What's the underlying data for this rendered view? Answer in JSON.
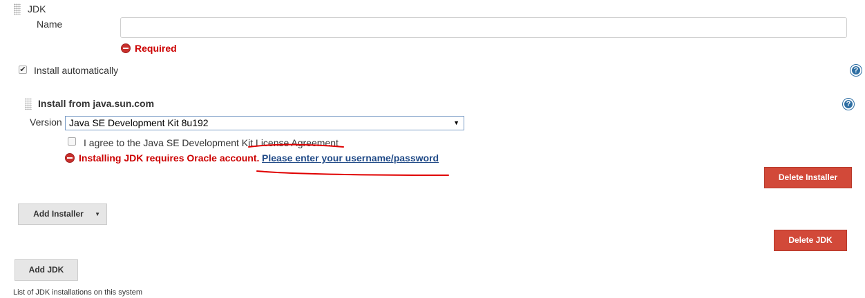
{
  "jdk": {
    "section_title": "JDK",
    "name_label": "Name",
    "name_value": "",
    "required_text": "Required",
    "install_automatically_label": "Install automatically",
    "install_automatically_checked": true
  },
  "installer": {
    "title": "Install from java.sun.com",
    "version_label": "Version",
    "version_selected": "Java SE Development Kit 8u192",
    "agree_label": "I agree to the Java SE Development Kit License Agreement",
    "agree_checked": false,
    "error_text": "Installing JDK requires Oracle account.",
    "error_link": "Please enter your username/password",
    "delete_installer_label": "Delete Installer"
  },
  "buttons": {
    "add_installer_label": "Add Installer",
    "delete_jdk_label": "Delete JDK",
    "add_jdk_label": "Add JDK"
  },
  "footer": {
    "description": "List of JDK installations on this system"
  },
  "colors": {
    "error": "#cc0000",
    "danger_button": "#d24939",
    "help_icon": "#2d6ea3",
    "annotation": "#e00000"
  },
  "icons": [
    "drag-handle-icon",
    "error-icon",
    "help-icon",
    "checkbox-check-icon",
    "dropdown-arrow-icon",
    "caret-down-icon"
  ]
}
